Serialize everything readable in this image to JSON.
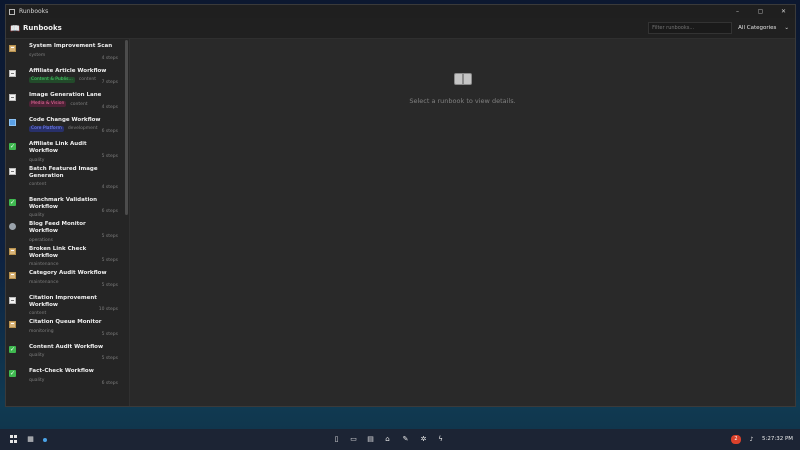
{
  "window": {
    "title": "Runbooks",
    "controls": [
      "–",
      "▢",
      "✕"
    ]
  },
  "header": {
    "title": "Runbooks",
    "filter_placeholder": "Filter runbooks...",
    "category": "All Categories"
  },
  "runbooks": [
    {
      "icon": "clip",
      "title": "System Improvement Scan",
      "category": "system",
      "tag": "",
      "tag_color": "",
      "steps": "4 steps"
    },
    {
      "icon": "memo",
      "title": "Affiliate Article Workflow",
      "category": "content",
      "tag": "Content & Publis...",
      "tag_color": "green",
      "steps": "7 steps"
    },
    {
      "icon": "memo",
      "title": "Image Generation Lane",
      "category": "content",
      "tag": "Media & Vision",
      "tag_color": "pink",
      "steps": "4 steps"
    },
    {
      "icon": "laptop",
      "title": "Code Change Workflow",
      "category": "development",
      "tag": "Core Platform",
      "tag_color": "blue",
      "steps": "6 steps"
    },
    {
      "icon": "check",
      "title": "Affiliate Link Audit Workflow",
      "category": "quality",
      "tag": "",
      "tag_color": "",
      "steps": "5 steps"
    },
    {
      "icon": "memo",
      "title": "Batch Featured Image Generation",
      "category": "content",
      "tag": "",
      "tag_color": "",
      "steps": "4 steps"
    },
    {
      "icon": "check",
      "title": "Benchmark Validation Workflow",
      "category": "quality",
      "tag": "",
      "tag_color": "",
      "steps": "6 steps"
    },
    {
      "icon": "gear",
      "title": "Blog Feed Monitor Workflow",
      "category": "operations",
      "tag": "",
      "tag_color": "",
      "steps": "5 steps"
    },
    {
      "icon": "clip",
      "title": "Broken Link Check Workflow",
      "category": "maintenance",
      "tag": "",
      "tag_color": "",
      "steps": "5 steps"
    },
    {
      "icon": "clip",
      "title": "Category Audit Workflow",
      "category": "maintenance",
      "tag": "",
      "tag_color": "",
      "steps": "5 steps"
    },
    {
      "icon": "memo",
      "title": "Citation Improvement Workflow",
      "category": "content",
      "tag": "",
      "tag_color": "",
      "steps": "10 steps"
    },
    {
      "icon": "clip",
      "title": "Citation Queue Monitor",
      "category": "monitoring",
      "tag": "",
      "tag_color": "",
      "steps": "5 steps"
    },
    {
      "icon": "check",
      "title": "Content Audit Workflow",
      "category": "quality",
      "tag": "",
      "tag_color": "",
      "steps": "5 steps"
    },
    {
      "icon": "check",
      "title": "Fact-Check Workflow",
      "category": "quality",
      "tag": "",
      "tag_color": "",
      "steps": "6 steps"
    }
  ],
  "main": {
    "placeholder": "Select a runbook to view details."
  },
  "taskbar": {
    "notification_count": "2",
    "time": "5:27:32 PM"
  }
}
